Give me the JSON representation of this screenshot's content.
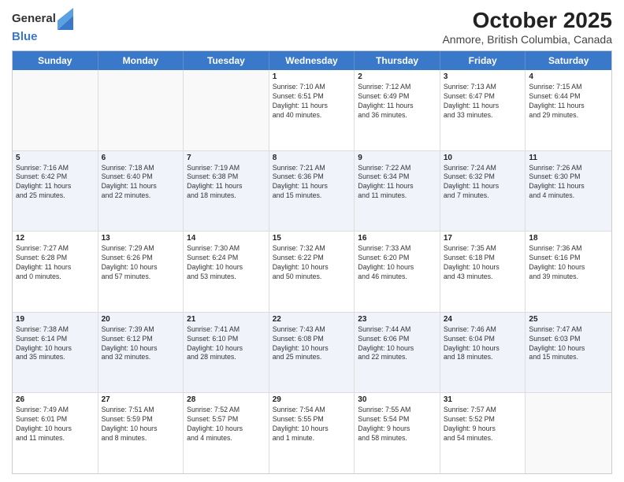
{
  "header": {
    "logo_general": "General",
    "logo_blue": "Blue",
    "main_title": "October 2025",
    "subtitle": "Anmore, British Columbia, Canada"
  },
  "day_headers": [
    "Sunday",
    "Monday",
    "Tuesday",
    "Wednesday",
    "Thursday",
    "Friday",
    "Saturday"
  ],
  "rows": [
    {
      "alt": false,
      "cells": [
        {
          "date": "",
          "info": ""
        },
        {
          "date": "",
          "info": ""
        },
        {
          "date": "",
          "info": ""
        },
        {
          "date": "1",
          "info": "Sunrise: 7:10 AM\nSunset: 6:51 PM\nDaylight: 11 hours\nand 40 minutes."
        },
        {
          "date": "2",
          "info": "Sunrise: 7:12 AM\nSunset: 6:49 PM\nDaylight: 11 hours\nand 36 minutes."
        },
        {
          "date": "3",
          "info": "Sunrise: 7:13 AM\nSunset: 6:47 PM\nDaylight: 11 hours\nand 33 minutes."
        },
        {
          "date": "4",
          "info": "Sunrise: 7:15 AM\nSunset: 6:44 PM\nDaylight: 11 hours\nand 29 minutes."
        }
      ]
    },
    {
      "alt": true,
      "cells": [
        {
          "date": "5",
          "info": "Sunrise: 7:16 AM\nSunset: 6:42 PM\nDaylight: 11 hours\nand 25 minutes."
        },
        {
          "date": "6",
          "info": "Sunrise: 7:18 AM\nSunset: 6:40 PM\nDaylight: 11 hours\nand 22 minutes."
        },
        {
          "date": "7",
          "info": "Sunrise: 7:19 AM\nSunset: 6:38 PM\nDaylight: 11 hours\nand 18 minutes."
        },
        {
          "date": "8",
          "info": "Sunrise: 7:21 AM\nSunset: 6:36 PM\nDaylight: 11 hours\nand 15 minutes."
        },
        {
          "date": "9",
          "info": "Sunrise: 7:22 AM\nSunset: 6:34 PM\nDaylight: 11 hours\nand 11 minutes."
        },
        {
          "date": "10",
          "info": "Sunrise: 7:24 AM\nSunset: 6:32 PM\nDaylight: 11 hours\nand 7 minutes."
        },
        {
          "date": "11",
          "info": "Sunrise: 7:26 AM\nSunset: 6:30 PM\nDaylight: 11 hours\nand 4 minutes."
        }
      ]
    },
    {
      "alt": false,
      "cells": [
        {
          "date": "12",
          "info": "Sunrise: 7:27 AM\nSunset: 6:28 PM\nDaylight: 11 hours\nand 0 minutes."
        },
        {
          "date": "13",
          "info": "Sunrise: 7:29 AM\nSunset: 6:26 PM\nDaylight: 10 hours\nand 57 minutes."
        },
        {
          "date": "14",
          "info": "Sunrise: 7:30 AM\nSunset: 6:24 PM\nDaylight: 10 hours\nand 53 minutes."
        },
        {
          "date": "15",
          "info": "Sunrise: 7:32 AM\nSunset: 6:22 PM\nDaylight: 10 hours\nand 50 minutes."
        },
        {
          "date": "16",
          "info": "Sunrise: 7:33 AM\nSunset: 6:20 PM\nDaylight: 10 hours\nand 46 minutes."
        },
        {
          "date": "17",
          "info": "Sunrise: 7:35 AM\nSunset: 6:18 PM\nDaylight: 10 hours\nand 43 minutes."
        },
        {
          "date": "18",
          "info": "Sunrise: 7:36 AM\nSunset: 6:16 PM\nDaylight: 10 hours\nand 39 minutes."
        }
      ]
    },
    {
      "alt": true,
      "cells": [
        {
          "date": "19",
          "info": "Sunrise: 7:38 AM\nSunset: 6:14 PM\nDaylight: 10 hours\nand 35 minutes."
        },
        {
          "date": "20",
          "info": "Sunrise: 7:39 AM\nSunset: 6:12 PM\nDaylight: 10 hours\nand 32 minutes."
        },
        {
          "date": "21",
          "info": "Sunrise: 7:41 AM\nSunset: 6:10 PM\nDaylight: 10 hours\nand 28 minutes."
        },
        {
          "date": "22",
          "info": "Sunrise: 7:43 AM\nSunset: 6:08 PM\nDaylight: 10 hours\nand 25 minutes."
        },
        {
          "date": "23",
          "info": "Sunrise: 7:44 AM\nSunset: 6:06 PM\nDaylight: 10 hours\nand 22 minutes."
        },
        {
          "date": "24",
          "info": "Sunrise: 7:46 AM\nSunset: 6:04 PM\nDaylight: 10 hours\nand 18 minutes."
        },
        {
          "date": "25",
          "info": "Sunrise: 7:47 AM\nSunset: 6:03 PM\nDaylight: 10 hours\nand 15 minutes."
        }
      ]
    },
    {
      "alt": false,
      "cells": [
        {
          "date": "26",
          "info": "Sunrise: 7:49 AM\nSunset: 6:01 PM\nDaylight: 10 hours\nand 11 minutes."
        },
        {
          "date": "27",
          "info": "Sunrise: 7:51 AM\nSunset: 5:59 PM\nDaylight: 10 hours\nand 8 minutes."
        },
        {
          "date": "28",
          "info": "Sunrise: 7:52 AM\nSunset: 5:57 PM\nDaylight: 10 hours\nand 4 minutes."
        },
        {
          "date": "29",
          "info": "Sunrise: 7:54 AM\nSunset: 5:55 PM\nDaylight: 10 hours\nand 1 minute."
        },
        {
          "date": "30",
          "info": "Sunrise: 7:55 AM\nSunset: 5:54 PM\nDaylight: 9 hours\nand 58 minutes."
        },
        {
          "date": "31",
          "info": "Sunrise: 7:57 AM\nSunset: 5:52 PM\nDaylight: 9 hours\nand 54 minutes."
        },
        {
          "date": "",
          "info": ""
        }
      ]
    }
  ]
}
